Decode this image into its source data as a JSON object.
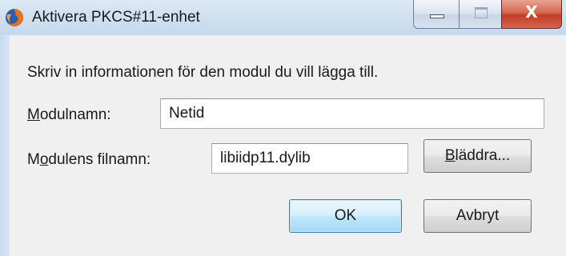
{
  "window": {
    "title": "Aktivera PKCS#11-enhet",
    "caption": {
      "minimize_glyph": "minimize-icon",
      "maximize_glyph": "maximize-icon",
      "close_glyph": "close-icon",
      "close_text": "X"
    }
  },
  "dialog": {
    "instruction": "Skriv in informationen för den modul du vill lägga till.",
    "module_name": {
      "label_accel": "M",
      "label_rest": "odulnamn:",
      "value": "Netid"
    },
    "module_file": {
      "label_pre": "M",
      "label_accel": "o",
      "label_rest": "dulens filnamn:",
      "value": "libiidp11.dylib"
    },
    "browse_button": {
      "accel": "B",
      "rest": "läddra..."
    },
    "ok_button": "OK",
    "cancel_button": "Avbryt"
  },
  "colors": {
    "titlebar": "#cfe0f1",
    "dialog_bg": "#f0f0f0",
    "close_button": "#c43c25",
    "default_button_border": "#3c7fb1"
  }
}
